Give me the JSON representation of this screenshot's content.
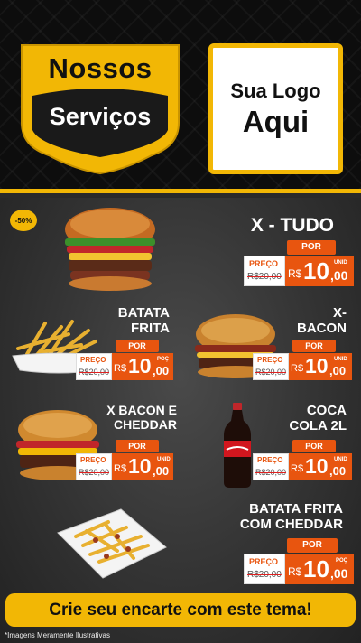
{
  "header": {
    "badge_line1": "Nossos",
    "badge_line2": "Serviços",
    "logo_line1": "Sua Logo",
    "logo_line2": "Aqui"
  },
  "discount_badge": "-50%",
  "products": [
    {
      "title": "X - TUDO",
      "preco_label": "PREÇO",
      "old_price": "R$20,00",
      "por_label": "POR",
      "currency": "R$",
      "price_int": "10",
      "price_cents": ",00",
      "unit": "UNID",
      "food_icon": "burger-icon"
    },
    {
      "title_line1": "BATATA",
      "title_line2": "FRITA",
      "preco_label": "PREÇO",
      "old_price": "R$20,00",
      "por_label": "POR",
      "currency": "R$",
      "price_int": "10",
      "price_cents": ",00",
      "unit": "POÇ",
      "food_icon": "fries-icon"
    },
    {
      "title_line1": "X-",
      "title_line2": "BACON",
      "preco_label": "PREÇO",
      "old_price": "R$20,00",
      "por_label": "POR",
      "currency": "R$",
      "price_int": "10",
      "price_cents": ",00",
      "unit": "UNID",
      "food_icon": "burger-icon"
    },
    {
      "title_line1": "X BACON E",
      "title_line2": "CHEDDAR",
      "preco_label": "PREÇO",
      "old_price": "R$20,00",
      "por_label": "POR",
      "currency": "R$",
      "price_int": "10",
      "price_cents": ",00",
      "unit": "UNID",
      "food_icon": "burger-icon"
    },
    {
      "title_line1": "COCA",
      "title_line2": "COLA 2L",
      "preco_label": "PREÇO",
      "old_price": "R$20,00",
      "por_label": "POR",
      "currency": "R$",
      "price_int": "10",
      "price_cents": ",00",
      "unit": "UNID",
      "food_icon": "soda-bottle-icon"
    },
    {
      "title_line1": "BATATA FRITA",
      "title_line2": "COM CHEDDAR",
      "preco_label": "PREÇO",
      "old_price": "R$20,00",
      "por_label": "POR",
      "currency": "R$",
      "price_int": "10",
      "price_cents": ",00",
      "unit": "POÇ",
      "food_icon": "fries-icon"
    }
  ],
  "cta": "Crie seu encarte com este tema!",
  "disclaimer": "*Imagens Meramente Ilustrativas",
  "colors": {
    "accent_yellow": "#f2b705",
    "price_orange": "#e8550f",
    "header_bg": "#0d0d0d"
  }
}
